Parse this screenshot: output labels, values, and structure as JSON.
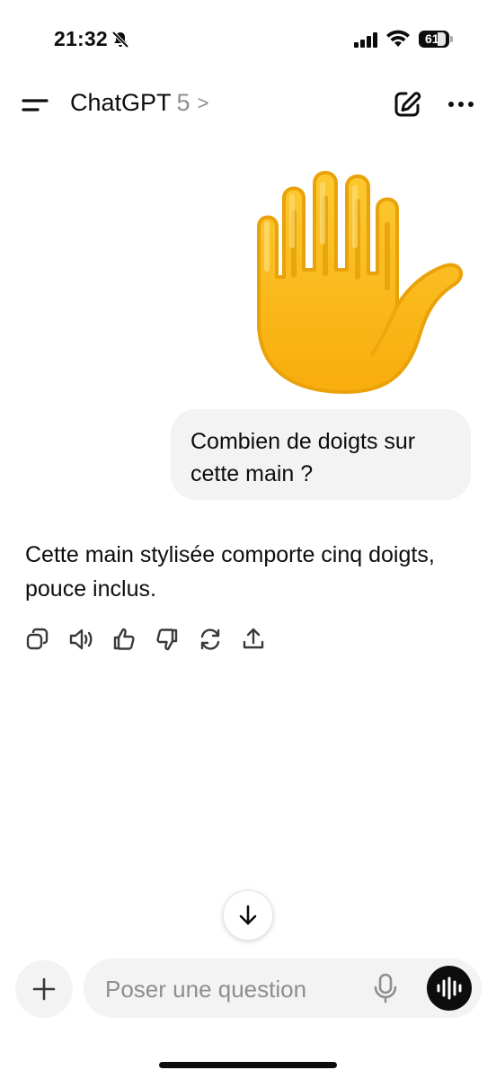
{
  "status_bar": {
    "time": "21:32",
    "battery": "61"
  },
  "header": {
    "title": "ChatGPT",
    "version": "5",
    "chevron": ">"
  },
  "conversation": {
    "user_message": "Combien de doigts sur cette main ?",
    "assistant_message": "Cette main stylisée comporte cinq doigts, pouce inclus.",
    "user_image": "raised-hand-emoji"
  },
  "actions": [
    "copy-icon",
    "speaker-icon",
    "thumbs-up-icon",
    "thumbs-down-icon",
    "regenerate-icon",
    "share-icon"
  ],
  "composer": {
    "placeholder": "Poser une question"
  },
  "colors": {
    "bubble": "#f3f3f3",
    "text": "#0d0d0d",
    "muted": "#8e8e8e",
    "hand": "#fbbd16"
  }
}
